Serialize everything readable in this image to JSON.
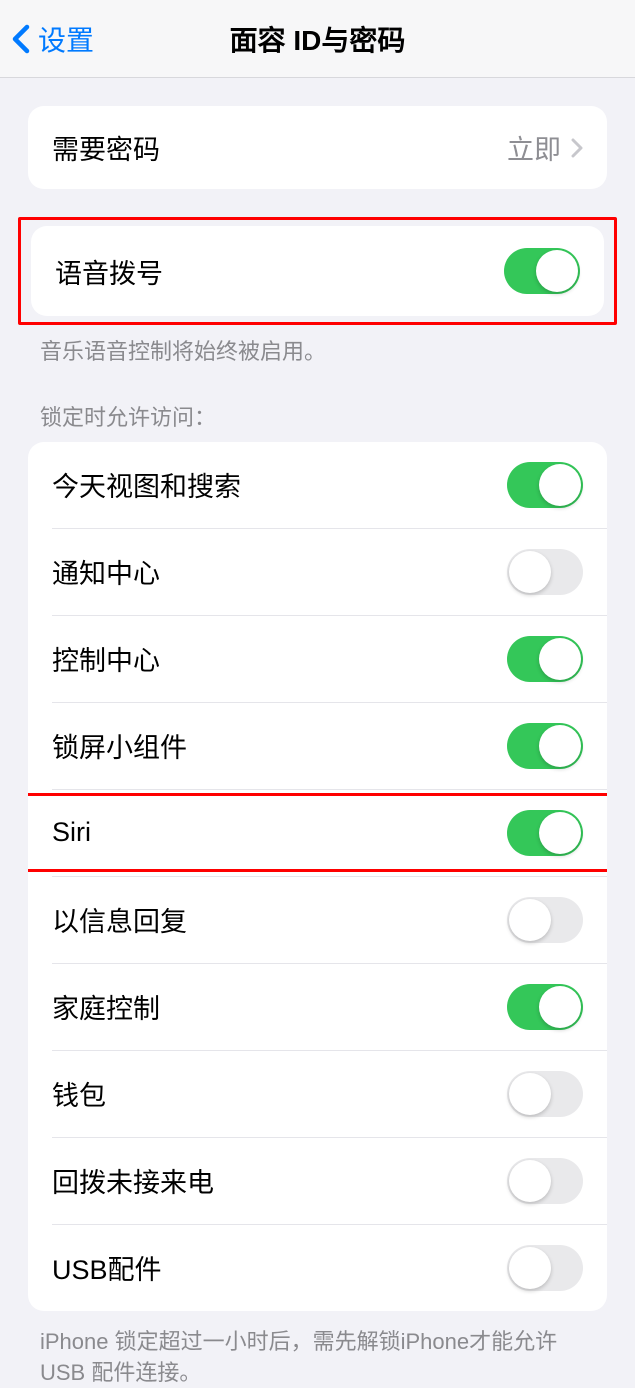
{
  "nav": {
    "back": "设置",
    "title": "面容 ID与密码"
  },
  "require_passcode": {
    "label": "需要密码",
    "value": "立即"
  },
  "voice_dial": {
    "label": "语音拨号",
    "footer": "音乐语音控制将始终被启用。",
    "on": true
  },
  "lock_access": {
    "header": "锁定时允许访问：",
    "items": [
      {
        "label": "今天视图和搜索",
        "on": true
      },
      {
        "label": "通知中心",
        "on": false
      },
      {
        "label": "控制中心",
        "on": true
      },
      {
        "label": "锁屏小组件",
        "on": true
      },
      {
        "label": "Siri",
        "on": true,
        "highlighted": true
      },
      {
        "label": "以信息回复",
        "on": false
      },
      {
        "label": "家庭控制",
        "on": true
      },
      {
        "label": "钱包",
        "on": false
      },
      {
        "label": "回拨未接来电",
        "on": false
      },
      {
        "label": "USB配件",
        "on": false
      }
    ],
    "footer": "iPhone 锁定超过一小时后，需先解锁iPhone才能允许USB 配件连接。"
  }
}
